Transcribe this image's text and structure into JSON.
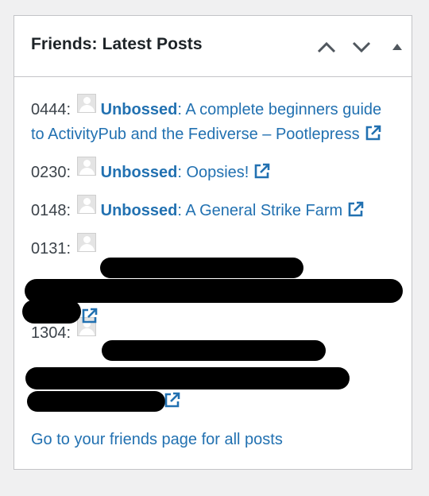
{
  "widget": {
    "title": "Friends: Latest Posts",
    "controls": {
      "move_up_label": "Move up",
      "move_down_label": "Move down",
      "toggle_label": "Toggle panel"
    }
  },
  "posts": [
    {
      "time": "0444:",
      "author": "Unbossed",
      "separator": ": ",
      "title": "A complete beginners guide to ActivityPub and the Fediverse – Pootlepress"
    },
    {
      "time": "0230:",
      "author": "Unbossed",
      "separator": ": ",
      "title": "Oopsies!"
    },
    {
      "time": "0148:",
      "author": "Unbossed",
      "separator": ": ",
      "title": "A General Strike Farm"
    },
    {
      "time": "0131:",
      "author": "",
      "separator": "",
      "title": ""
    },
    {
      "time": "1304:",
      "author": "",
      "separator": "",
      "title": ""
    }
  ],
  "footer": {
    "link_text": "Go to your friends page for all posts"
  },
  "colors": {
    "link": "#2271b1",
    "text": "#3c434a",
    "title": "#1d2327",
    "border": "#c3c4c7",
    "background": "#f0f0f1",
    "redaction": "#000000"
  },
  "icons": {
    "avatar": "default-avatar-icon",
    "external": "external-link-icon",
    "up": "chevron-up-icon",
    "down": "chevron-down-icon",
    "toggle": "triangle-up-icon"
  }
}
